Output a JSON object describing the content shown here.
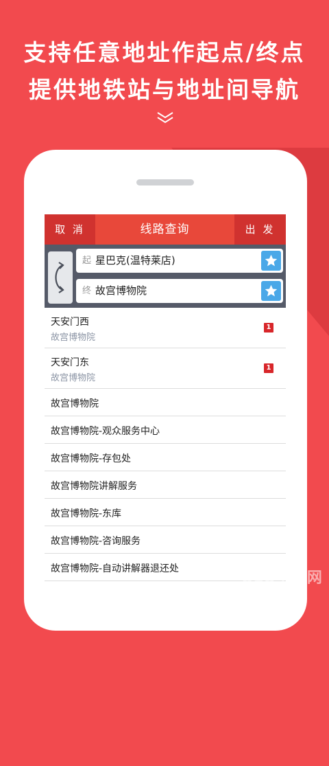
{
  "promo": {
    "line1": "支持任意地址作起点/终点",
    "line2": "提供地铁站与地址间导航",
    "scroll_icon": "double-chevron-down-icon"
  },
  "header": {
    "cancel_label": "取 消",
    "title": "线路查询",
    "go_label": "出 发"
  },
  "route": {
    "start_tag": "起",
    "start_value": "星巴克(温特莱店)",
    "end_tag": "终",
    "end_value": "故宫博物院",
    "swap_icon": "swap-arrow-icon",
    "favorite_icon": "star-icon"
  },
  "results": [
    {
      "title": "天安门西",
      "subtitle": "故宫博物院",
      "line": "1"
    },
    {
      "title": "天安门东",
      "subtitle": "故宫博物院",
      "line": "1"
    },
    {
      "title": "故宫博物院"
    },
    {
      "title": "故宫博物院-观众服务中心"
    },
    {
      "title": "故宫博物院-存包处"
    },
    {
      "title": "故宫博物院讲解服务"
    },
    {
      "title": "故宫博物院-东库"
    },
    {
      "title": "故宫博物院-咨询服务"
    },
    {
      "title": "故宫博物院-自动讲解器退还处"
    }
  ],
  "watermark": "818手游网",
  "colors": {
    "background": "#f24a4e",
    "nav_bar": "#d0322f",
    "nav_title_bg": "#e8483a",
    "route_panel": "#555a68",
    "star_button": "#4aa8e8",
    "line_badge": "#d8262a"
  }
}
